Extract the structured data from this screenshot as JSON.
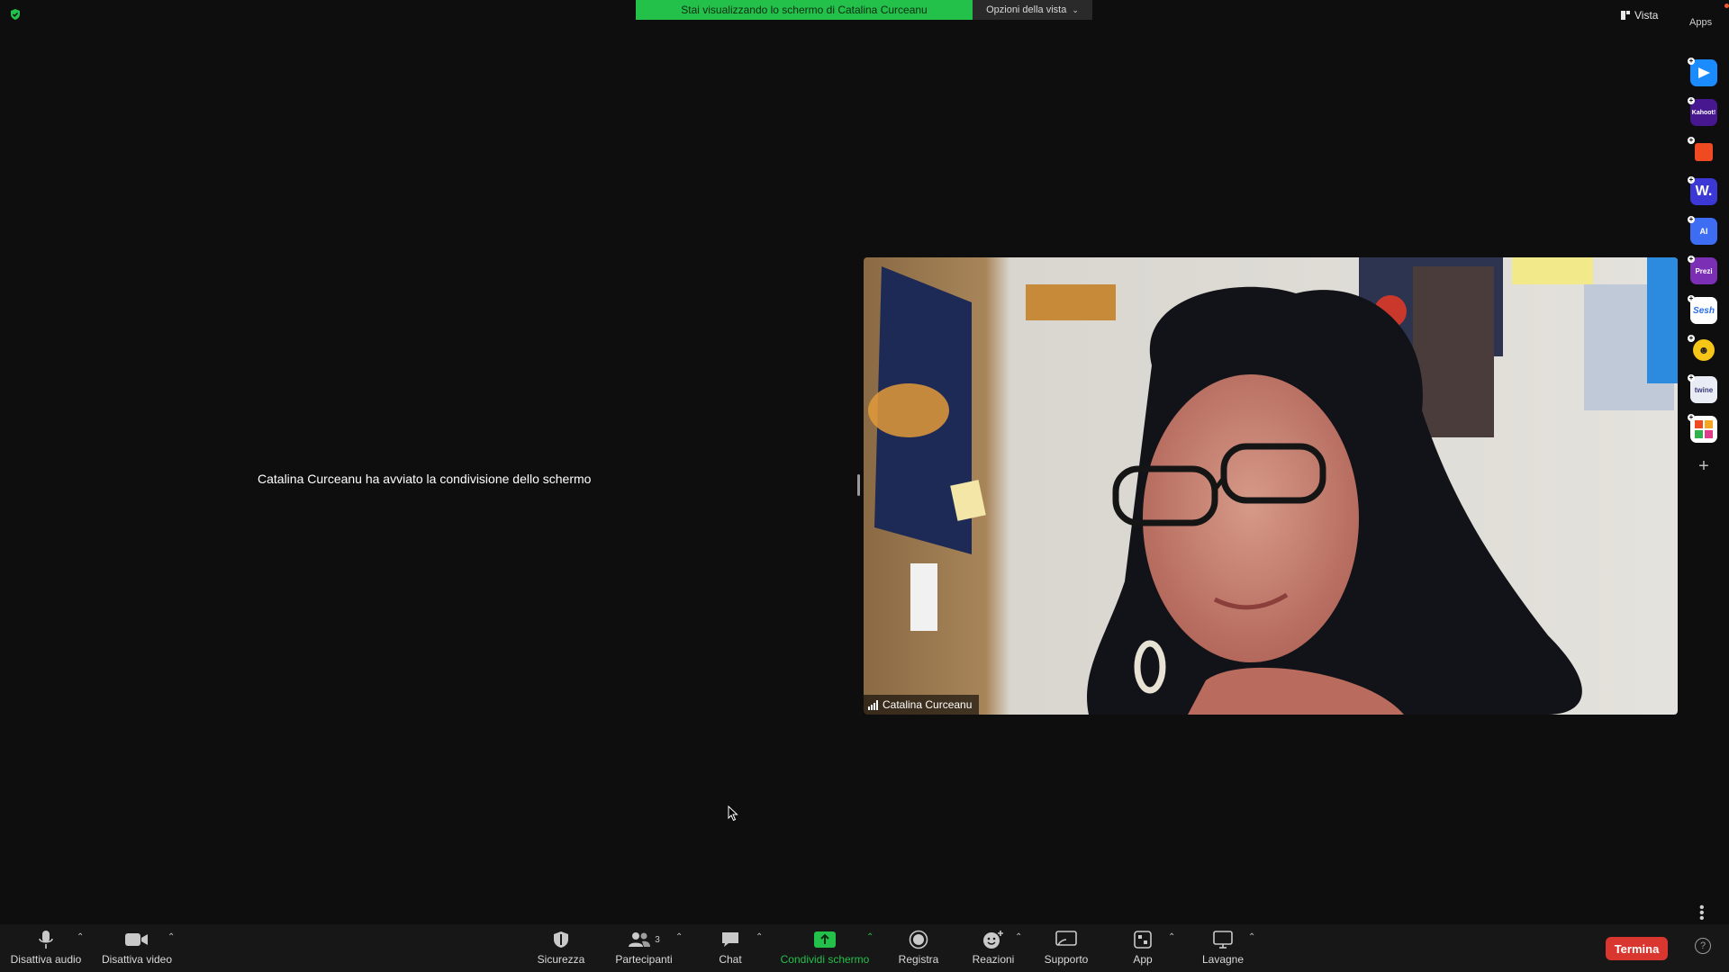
{
  "banner": {
    "share_text": "Stai visualizzando lo schermo di Catalina Curceanu",
    "view_options_label": "Opzioni della vista"
  },
  "top_right": {
    "view_label": "Vista",
    "apps_label": "Apps"
  },
  "main": {
    "share_started_message": "Catalina Curceanu ha avviato la condivisione dello schermo"
  },
  "video": {
    "participant_name": "Catalina Curceanu"
  },
  "app_rail": {
    "apps": [
      {
        "name": "Presentation app",
        "label": "",
        "color": "#1a8cff"
      },
      {
        "name": "Kahoot!",
        "label": "Kahoot!",
        "color": "#46178f"
      },
      {
        "name": "Red app",
        "label": "",
        "color": "#f04a23"
      },
      {
        "name": "Wooclap",
        "label": "W.",
        "color": "#3b38d6"
      },
      {
        "name": "AI app",
        "label": "AI",
        "color": "#3d6df2"
      },
      {
        "name": "Prezi",
        "label": "Prezi",
        "color": "#7b2fb5"
      },
      {
        "name": "Sesh",
        "label": "Sesh",
        "color": "#ffffff"
      },
      {
        "name": "Emoji app",
        "label": "",
        "color": "#f5c518"
      },
      {
        "name": "twine",
        "label": "twine",
        "color": "#e9ecf5"
      },
      {
        "name": "Mosaic app",
        "label": "",
        "color": "#ffffff"
      }
    ]
  },
  "toolbar": {
    "mute_audio": "Disattiva audio",
    "stop_video": "Disattiva video",
    "security": "Sicurezza",
    "participants": "Partecipanti",
    "participants_count": "3",
    "chat": "Chat",
    "share_screen": "Condividi schermo",
    "record": "Registra",
    "reactions": "Reazioni",
    "support": "Supporto",
    "apps": "App",
    "whiteboards": "Lavagne",
    "end": "Termina"
  },
  "colors": {
    "accent_green": "#23c04a",
    "end_red": "#d9362f",
    "background": "#0e0e0e"
  }
}
